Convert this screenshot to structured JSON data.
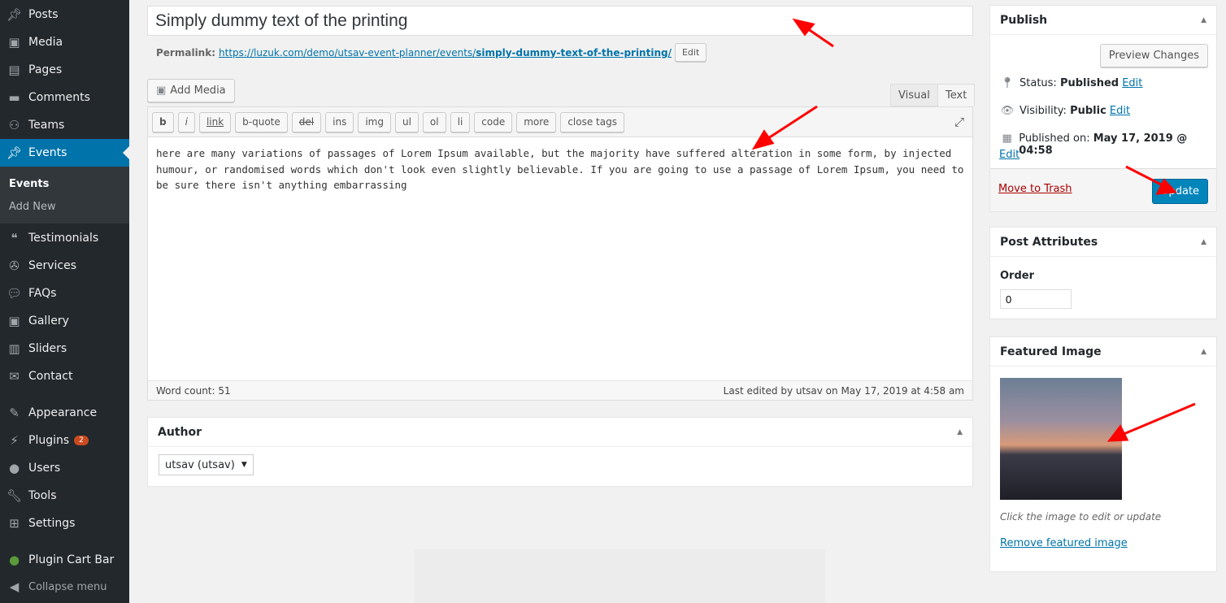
{
  "sidebar": {
    "items": [
      {
        "label": "Posts",
        "icon": "pin-icon"
      },
      {
        "label": "Media",
        "icon": "media-icon"
      },
      {
        "label": "Pages",
        "icon": "pages-icon"
      },
      {
        "label": "Comments",
        "icon": "comments-icon"
      },
      {
        "label": "Teams",
        "icon": "groups-icon"
      },
      {
        "label": "Events",
        "icon": "pin-icon"
      },
      {
        "label": "Testimonials",
        "icon": "testimonial-icon"
      },
      {
        "label": "Services",
        "icon": "services-icon"
      },
      {
        "label": "FAQs",
        "icon": "faq-icon"
      },
      {
        "label": "Gallery",
        "icon": "gallery-icon"
      },
      {
        "label": "Sliders",
        "icon": "slides-icon"
      },
      {
        "label": "Contact",
        "icon": "email-icon"
      },
      {
        "label": "Appearance",
        "icon": "brush-icon"
      },
      {
        "label": "Plugins",
        "icon": "plugin-icon",
        "badge": "2"
      },
      {
        "label": "Users",
        "icon": "users-icon"
      },
      {
        "label": "Tools",
        "icon": "wrench-icon"
      },
      {
        "label": "Settings",
        "icon": "settings-icon"
      },
      {
        "label": "Plugin Cart Bar",
        "icon": "leaf-icon"
      },
      {
        "label": "Collapse menu",
        "icon": "collapse-icon"
      }
    ],
    "submenu": [
      "Events",
      "Add New"
    ]
  },
  "title": "Simply dummy text of the printing",
  "permalink": {
    "label": "Permalink:",
    "base": "https://luzuk.com/demo/utsav-event-planner/events/",
    "slug": "simply-dummy-text-of-the-printing/",
    "edit": "Edit"
  },
  "editor": {
    "add_media": "Add Media",
    "tabs": [
      "Visual",
      "Text"
    ],
    "quicktags": [
      "b",
      "i",
      "link",
      "b-quote",
      "del",
      "ins",
      "img",
      "ul",
      "ol",
      "li",
      "code",
      "more",
      "close tags"
    ],
    "content": "here are many variations of passages of Lorem Ipsum available, but the majority have suffered alteration in some form, by injected humour, or randomised words which don't look even slightly believable. If you are going to use a passage of Lorem Ipsum, you need to be sure there isn't anything embarrassing",
    "word_count": "Word count: 51",
    "last_edited": "Last edited by utsav on May 17, 2019 at 4:58 am"
  },
  "author": {
    "title": "Author",
    "value": "utsav (utsav)"
  },
  "publish": {
    "title": "Publish",
    "preview": "Preview Changes",
    "status_label": "Status:",
    "status": "Published",
    "visibility_label": "Visibility:",
    "visibility": "Public",
    "published_label": "Published on:",
    "published": "May 17, 2019 @ 04:58",
    "edit": "Edit",
    "trash": "Move to Trash",
    "update": "Update"
  },
  "attributes": {
    "title": "Post Attributes",
    "order_label": "Order",
    "order": "0"
  },
  "featured": {
    "title": "Featured Image",
    "hint": "Click the image to edit or update",
    "remove": "Remove featured image"
  },
  "colors": {
    "accent": "#0073aa",
    "sidebar": "#23282d",
    "annotation": "#ff0000"
  }
}
